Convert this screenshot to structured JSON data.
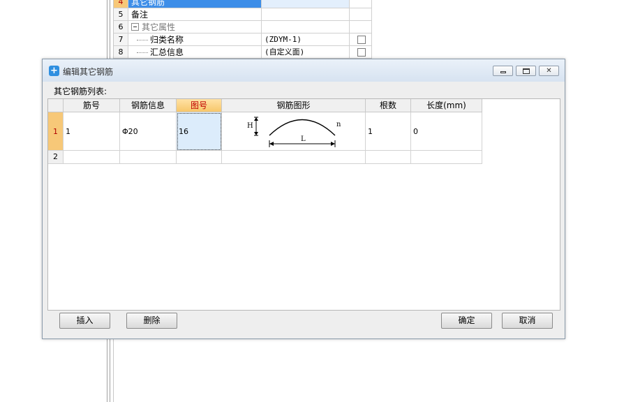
{
  "background_grid": {
    "rows": [
      {
        "num": "4",
        "name": "其它钢筋",
        "value": "",
        "checkbox": false,
        "selected": true,
        "indent": false,
        "tree_box": false
      },
      {
        "num": "5",
        "name": "备注",
        "value": "",
        "checkbox": false,
        "selected": false,
        "indent": false,
        "tree_box": false
      },
      {
        "num": "6",
        "name": "其它属性",
        "value": "",
        "checkbox": false,
        "selected": false,
        "indent": false,
        "tree_box": true
      },
      {
        "num": "7",
        "name": "归类名称",
        "value": "(ZDYM-1)",
        "checkbox": true,
        "selected": false,
        "indent": true,
        "tree_box": false
      },
      {
        "num": "8",
        "name": "汇总信息",
        "value": "(自定义面)",
        "checkbox": true,
        "selected": false,
        "indent": true,
        "tree_box": false
      }
    ]
  },
  "dialog": {
    "title": "编辑其它钢筋",
    "icon": "app-logo-icon",
    "list_label": "其它钢筋列表:",
    "columns": [
      "筋号",
      "钢筋信息",
      "图号",
      "钢筋图形",
      "根数",
      "长度(mm)"
    ],
    "active_column": "图号",
    "rows": [
      {
        "num": "1",
        "jin_hao": "1",
        "info": "Φ20",
        "tu_hao": "16",
        "shape": {
          "h": "H",
          "l": "L",
          "n": "n"
        },
        "count": "1",
        "length": "0"
      },
      {
        "num": "2",
        "jin_hao": "",
        "info": "",
        "tu_hao": "",
        "shape": null,
        "count": "",
        "length": ""
      }
    ],
    "buttons": {
      "insert": "插入",
      "delete": "删除",
      "ok": "确定",
      "cancel": "取消"
    },
    "window_controls": {
      "minimize": "minimize-icon",
      "restore": "restore-icon",
      "close": "close-icon"
    }
  }
}
